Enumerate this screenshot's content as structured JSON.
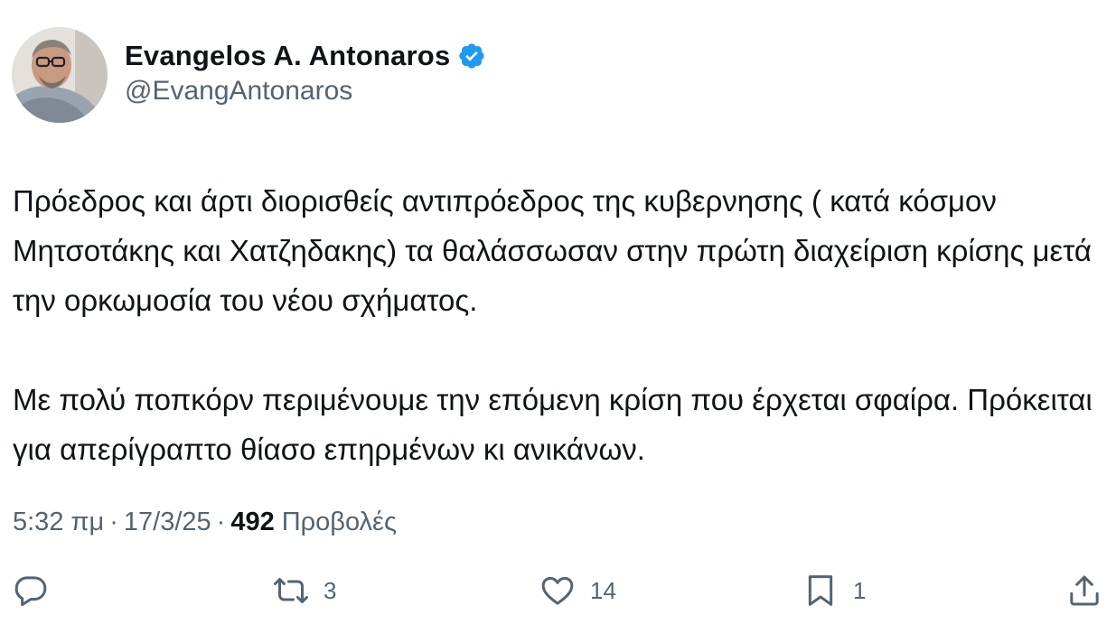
{
  "author": {
    "display_name": "Evangelos A. Antonaros",
    "handle": "@EvangAntonaros",
    "verified": true,
    "verified_color": "#1d9bf0"
  },
  "tweet": {
    "paragraphs": [
      "Πρόεδρος και άρτι διορισθείς αντιπρόεδρος της κυβερνησης ( κατά κόσμον Μητσοτάκης και Χατζηδακης) τα θαλάσσωσαν στην πρώτη διαχείριση κρίσης μετά την ορκωμοσία του νέου σχήματος.",
      "Με πολύ ποπκόρν περιμένουμε την επόμενη κρίση που έρχεται σφαίρα. Πρόκειται για απερίγραπτο θίασο επηρμένων κι ανικάνων."
    ]
  },
  "meta": {
    "time": "5:32 πμ",
    "date": "17/3/25",
    "separator": "·",
    "views_count": "492",
    "views_label": "Προβολές"
  },
  "actions": {
    "reply": {
      "icon": "reply-icon",
      "count": ""
    },
    "retweet": {
      "icon": "retweet-icon",
      "count": "3"
    },
    "like": {
      "icon": "heart-icon",
      "count": "14"
    },
    "bookmark": {
      "icon": "bookmark-icon",
      "count": "1"
    },
    "share": {
      "icon": "share-icon",
      "count": ""
    }
  },
  "colors": {
    "text_primary": "#0f1419",
    "text_secondary": "#536471",
    "icon": "#536471"
  }
}
